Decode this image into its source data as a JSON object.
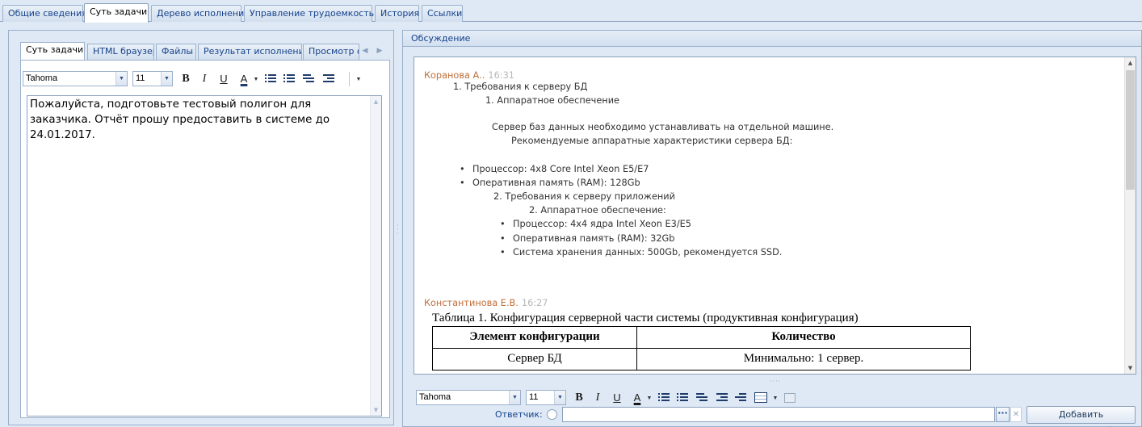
{
  "top_tabs": [
    "Общие сведения",
    "Суть задачи",
    "Дерево исполнения",
    "Управление трудоемкостью",
    "История",
    "Ссылки"
  ],
  "left": {
    "tabs": [
      "Суть задачи",
      "HTML браузер",
      "Файлы",
      "Результат исполнения",
      "Просмотр фа"
    ],
    "toolbar": {
      "font": "Tahoma",
      "size": "11"
    },
    "body_lines": [
      "Пожалуйста, подготовьте тестовый полигон для",
      "заказчика. Отчёт прошу предоставить в системе до",
      "24.01.2017."
    ]
  },
  "right": {
    "header": "Обсуждение",
    "comments": [
      {
        "author": "Коранова А..",
        "time": "16:31",
        "lines": {
          "l1": "1.   Требования к серверу БД",
          "l2": "1.   Аппаратное обеспечение",
          "l3": "Сервер баз данных необходимо устанавливать на отдельной машине.",
          "l4": "Рекомендуемые аппаратные характеристики сервера БД:",
          "b1": "Процессор: 4x8 Core Intel Xeon E5/E7",
          "b2": "Оперативная память (RAM): 128Gb",
          "l5": "2.   Требования к серверу приложений",
          "l6": "2.     Аппаратное обеспечение:",
          "b3": "Процессор: 4x4 ядра Intel Xeon E3/E5",
          "b4": "Оперативная память (RAM): 32Gb",
          "b5": "Система хранения данных: 500Gb, рекомендуется SSD."
        }
      },
      {
        "author": "Константинова Е.В.",
        "time": "16:27",
        "table_caption": "Таблица 1. Конфигурация серверной части системы (продуктивная конфигурация)",
        "table_headers": [
          "Элемент конфигурации",
          "Количество"
        ],
        "table_rows": [
          [
            "Сервер БД",
            "Минимально: 1 сервер."
          ]
        ]
      }
    ],
    "toolbar": {
      "font": "Tahoma",
      "size": "11"
    },
    "reply_label": "Ответчик:",
    "ellipsis": "···",
    "clear": "✕",
    "add_button": "Добавить комментарий"
  }
}
